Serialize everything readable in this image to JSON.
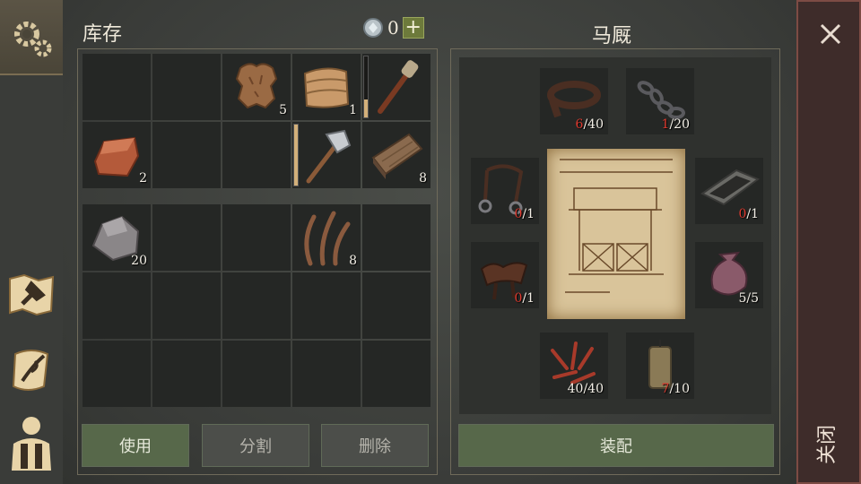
{
  "inventory": {
    "title": "库存",
    "currency": "0",
    "add_label": "+",
    "top_cells": [
      {
        "icon": "",
        "qty": ""
      },
      {
        "icon": "",
        "qty": ""
      },
      {
        "icon": "hide-icon",
        "qty": "5"
      },
      {
        "icon": "cloth-icon",
        "qty": "1"
      },
      {
        "icon": "torch-icon",
        "qty": ""
      },
      {
        "icon": "copper-ingot-icon",
        "qty": "2"
      },
      {
        "icon": "",
        "qty": ""
      },
      {
        "icon": "",
        "qty": ""
      },
      {
        "icon": "hammer-icon",
        "qty": ""
      },
      {
        "icon": "wood-plank-icon",
        "qty": "8"
      }
    ],
    "bottom_cells": [
      {
        "icon": "stone-icon",
        "qty": "20"
      },
      {
        "icon": "",
        "qty": ""
      },
      {
        "icon": "",
        "qty": ""
      },
      {
        "icon": "fiber-icon",
        "qty": "8"
      },
      {
        "icon": "",
        "qty": ""
      }
    ],
    "durability": {
      "torch": 0.3,
      "hammer": 1.0
    },
    "buttons": {
      "use": "使用",
      "split": "分割",
      "delete": "删除"
    }
  },
  "stable": {
    "title": "马厩",
    "equip_label": "装配",
    "slots": {
      "leather": {
        "icon": "leather-strap-icon",
        "cur": "6",
        "total": "/40"
      },
      "chain": {
        "icon": "chain-icon",
        "cur": "1",
        "total": "/20"
      },
      "bridle": {
        "icon": "bridle-icon",
        "cur": "0",
        "total": "/1"
      },
      "trough": {
        "icon": "trough-icon",
        "cur": "0",
        "total": "/1"
      },
      "saddle": {
        "icon": "saddle-icon",
        "cur": "0",
        "total": "/1"
      },
      "sack": {
        "icon": "sack-icon",
        "cur": "5",
        "total": "/5"
      },
      "nails": {
        "icon": "nails-icon",
        "cur": "40",
        "total": "/40"
      },
      "candle": {
        "icon": "candle-icon",
        "cur": "7",
        "total": "/10"
      }
    }
  },
  "close": {
    "label": "关闭"
  },
  "colors": {
    "accent_green": "#57684a",
    "deficit_red": "#e03a2f",
    "close_bg": "#3e2c2a"
  }
}
